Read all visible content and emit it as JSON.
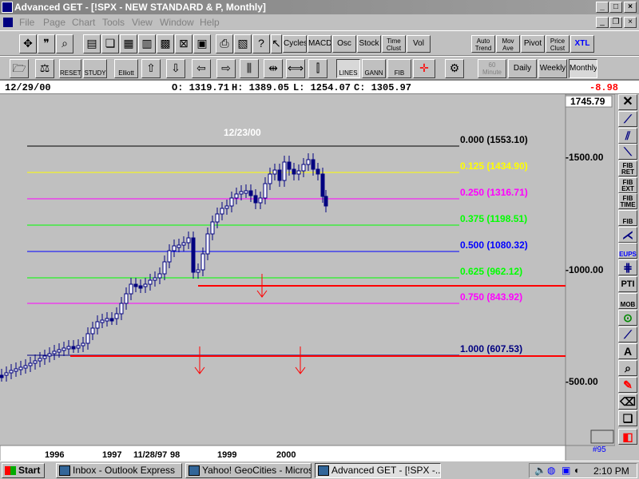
{
  "window": {
    "title": "Advanced GET - [!SPX    - NEW STANDARD & P, Monthly]"
  },
  "menu": [
    "File",
    "Page",
    "Chart",
    "Tools",
    "View",
    "Window",
    "Help"
  ],
  "toolbar1": {
    "studies": [
      "Cycles",
      "MACD",
      "Osc",
      "Stock",
      "Time\nClust",
      "Vol"
    ],
    "right": [
      "Auto\nTrend",
      "Mov\nAve",
      "Pivot",
      "Price\nClust",
      "XTL"
    ]
  },
  "toolbar2": {
    "labels": [
      "RESET",
      "STUDY",
      "Elliott",
      "LINES",
      "GANN",
      "FIB"
    ],
    "periods": [
      "60\nMinute",
      "Daily",
      "Weekly",
      "Monthly"
    ]
  },
  "info": {
    "date": "12/29/00",
    "open": "O: 1319.71",
    "high": "H: 1389.05",
    "low": "L: 1254.07",
    "close": "C: 1305.97",
    "change": "-8.98"
  },
  "chart": {
    "top_label": "12/23/00",
    "axis_top": "1745.79",
    "price_ticks": [
      "-1500.00",
      "-1000.00",
      "-500.00"
    ],
    "date_ticks": [
      "1996",
      "1997",
      "11/28/97",
      "98",
      "1999",
      "2000"
    ],
    "corner_label": "#95",
    "colors": {
      "background": "#c0c0c0",
      "candle": "#000080",
      "red": "#ff0000"
    },
    "fib_levels": [
      {
        "label": "0.000 (1553.10)",
        "color": "#000000"
      },
      {
        "label": "0.125 (1434.90)",
        "color": "#ffff00"
      },
      {
        "label": "0.250 (1316.71)",
        "color": "#ff00ff"
      },
      {
        "label": "0.375 (1198.51)",
        "color": "#00ff00"
      },
      {
        "label": "0.500 (1080.32)",
        "color": "#0000ff"
      },
      {
        "label": "0.625 (962.12)",
        "color": "#00ff00"
      },
      {
        "label": "0.750 (843.92)",
        "color": "#ff00ff"
      },
      {
        "label": "1.000 (607.53)",
        "color": "#000080"
      }
    ]
  },
  "right_tools": [
    "FIB\nRET",
    "FIB\nEXT",
    "FIB\nTIME",
    "FIB",
    "EUPS",
    "PTI",
    "MOB",
    "A"
  ],
  "taskbar": {
    "start": "Start",
    "tasks": [
      "Inbox - Outlook Express",
      "Yahoo! GeoCities - Micros...",
      "Advanced GET - [!SPX    -..."
    ],
    "clock": "2:10 PM"
  }
}
